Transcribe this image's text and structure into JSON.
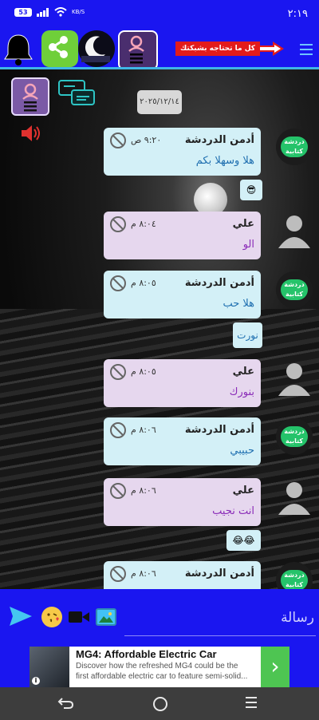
{
  "status_bar": {
    "time": "٢:١٩",
    "net_speed": "KB/S",
    "battery": "53"
  },
  "banner": {
    "text": "كل ما تحتاجه بشبكتك"
  },
  "chat": {
    "date": "٢٠٢٥/١٢/١٤",
    "messages": [
      {
        "sender": "أدمن الدردشة",
        "time": "٩:٢٠ ص",
        "text": "هلا وسهلا بكم",
        "kind": "admin"
      },
      {
        "sender": "علي",
        "time": "٨:٠٤ م",
        "text": "الو",
        "kind": "user"
      },
      {
        "sender": "أدمن الدردشة",
        "time": "٨:٠٥ م",
        "text": "هلا حب",
        "kind": "admin"
      },
      {
        "sender": "علي",
        "time": "٨:٠٥ م",
        "text": "بنورك",
        "kind": "user"
      },
      {
        "sender": "أدمن الدردشة",
        "time": "٨:٠٦ م",
        "text": "حبيبي",
        "kind": "admin"
      },
      {
        "sender": "علي",
        "time": "٨:٠٦ م",
        "text": "انت نجيب",
        "kind": "user"
      },
      {
        "sender": "أدمن الدردشة",
        "time": "٨:٠٦ م",
        "text": "",
        "kind": "admin"
      }
    ],
    "admin_avatar_text": "دردشة كتابية",
    "reactions": [
      "😎",
      "نورت",
      "😂😂"
    ]
  },
  "composer": {
    "placeholder": "رسالة"
  },
  "ad": {
    "title": "MG4: Affordable Electric Car",
    "description": "Discover how the refreshed MG4 could be the first affordable electric car to feature semi-solid...",
    "info": "i",
    "arrow": "›"
  }
}
